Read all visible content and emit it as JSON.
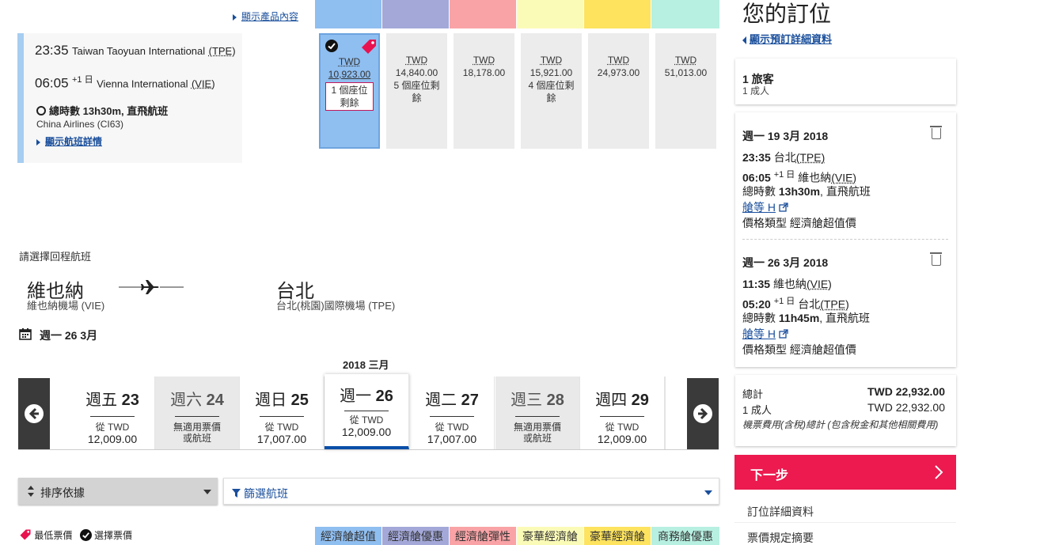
{
  "outbound": {
    "show_product": "顯示產品內容",
    "dep_time": "23:35",
    "dep_airport": "Taiwan Taoyuan International",
    "dep_code": "(TPE)",
    "arr_time": "06:05",
    "arr_plus": "+1 日",
    "arr_airport": "Vienna International",
    "arr_code": "(VIE)",
    "duration": "總時數 13h30m, 直飛航班",
    "airline": "China Airlines (CI63)",
    "flight_details": "顯示航班詳情"
  },
  "fares": [
    {
      "currency": "TWD",
      "price": "10,923.00",
      "seats": "1 個座位剩餘",
      "selected": true,
      "color": "#8fbef0"
    },
    {
      "currency": "TWD",
      "price": "14,840.00",
      "seats": "5 個座位剩餘",
      "selected": false,
      "color": "#a3a8d8"
    },
    {
      "currency": "TWD",
      "price": "18,178.00",
      "seats": "",
      "selected": false,
      "color": "#f9a3a6"
    },
    {
      "currency": "TWD",
      "price": "15,921.00",
      "seats": "4 個座位剩餘",
      "selected": false,
      "color": "#fbfbb8"
    },
    {
      "currency": "TWD",
      "price": "24,973.00",
      "seats": "",
      "selected": false,
      "color": "#fde35e"
    },
    {
      "currency": "TWD",
      "price": "51,013.00",
      "seats": "",
      "selected": false,
      "color": "#b7f0e1"
    }
  ],
  "return": {
    "heading": "請選擇回程航班",
    "from_city": "維也納",
    "from_airport": "維也納機場 (VIE)",
    "to_city": "台北",
    "to_airport": "台北(桃園)國際機場 (TPE)",
    "date": "週一 26 3月",
    "month_label": "2018 三月"
  },
  "days": [
    {
      "dow": "週五",
      "num": "23",
      "sub": "從 TWD",
      "price": "12,009.00",
      "available": true,
      "selected": false
    },
    {
      "dow": "週六",
      "num": "24",
      "sub": "無適用票價",
      "price": "或航班",
      "available": false,
      "selected": false
    },
    {
      "dow": "週日",
      "num": "25",
      "sub": "從 TWD",
      "price": "17,007.00",
      "available": true,
      "selected": false
    },
    {
      "dow": "週一",
      "num": "26",
      "sub": "從 TWD",
      "price": "12,009.00",
      "available": true,
      "selected": true
    },
    {
      "dow": "週二",
      "num": "27",
      "sub": "從 TWD",
      "price": "17,007.00",
      "available": true,
      "selected": false
    },
    {
      "dow": "週三",
      "num": "28",
      "sub": "無適用票價",
      "price": "或航班",
      "available": false,
      "selected": false
    },
    {
      "dow": "週四",
      "num": "29",
      "sub": "從 TWD",
      "price": "12,009.00",
      "available": true,
      "selected": false
    }
  ],
  "toolbar": {
    "sort_label": "排序依據",
    "filter_label": "篩選航班"
  },
  "legend": {
    "lowest": "最低票價",
    "selected": "選擇票價",
    "tabs": [
      {
        "label": "經濟艙超值",
        "color": "#8fbef0"
      },
      {
        "label": "經濟艙優惠",
        "color": "#a3a8d8"
      },
      {
        "label": "經濟艙彈性",
        "color": "#f9a3a6"
      },
      {
        "label": "豪華經濟艙",
        "color": "#fbfbb8"
      },
      {
        "label": "豪華經濟艙",
        "color": "#fde35e"
      },
      {
        "label": "商務艙優惠",
        "color": "#b7f0e1"
      }
    ]
  },
  "booking": {
    "title": "您的訂位",
    "show_details": "顯示預訂詳細資料",
    "pax_count": "1 旅客",
    "pax_detail": "1 成人",
    "seg1": {
      "date": "週一 19 3月 2018",
      "dep_time": "23:35",
      "dep": "台北",
      "dep_code": "(TPE)",
      "arr_time": "06:05",
      "plus": "+1 日",
      "arr": "維也納",
      "arr_code": "(VIE)",
      "dur_prefix": "總時數",
      "dur": "13h30m",
      "dur_suffix": ", 直飛航班",
      "cabin": "艙等 H",
      "fare_type": "價格類型 經濟艙超值價"
    },
    "seg2": {
      "date": "週一 26 3月 2018",
      "dep_time": "11:35",
      "dep": "維也納",
      "dep_code": "(VIE)",
      "arr_time": "05:20",
      "plus": "+1 日",
      "arr": "台北",
      "arr_code": "(TPE)",
      "dur_prefix": "總時數",
      "dur": "11h45m",
      "dur_suffix": ", 直飛航班",
      "cabin": "艙等 H",
      "fare_type": "價格類型 經濟艙超值價"
    },
    "total_label": "總計",
    "total_value": "TWD 22,932.00",
    "adult_label": "1 成人",
    "adult_value": "TWD 22,932.00",
    "note": "機票費用(含稅)總計 (包含稅金和其他相關費用)",
    "next": "下一步",
    "link1": "訂位詳細資料",
    "link2": "票價規定摘要",
    "next_color": "#ec1a4f"
  }
}
